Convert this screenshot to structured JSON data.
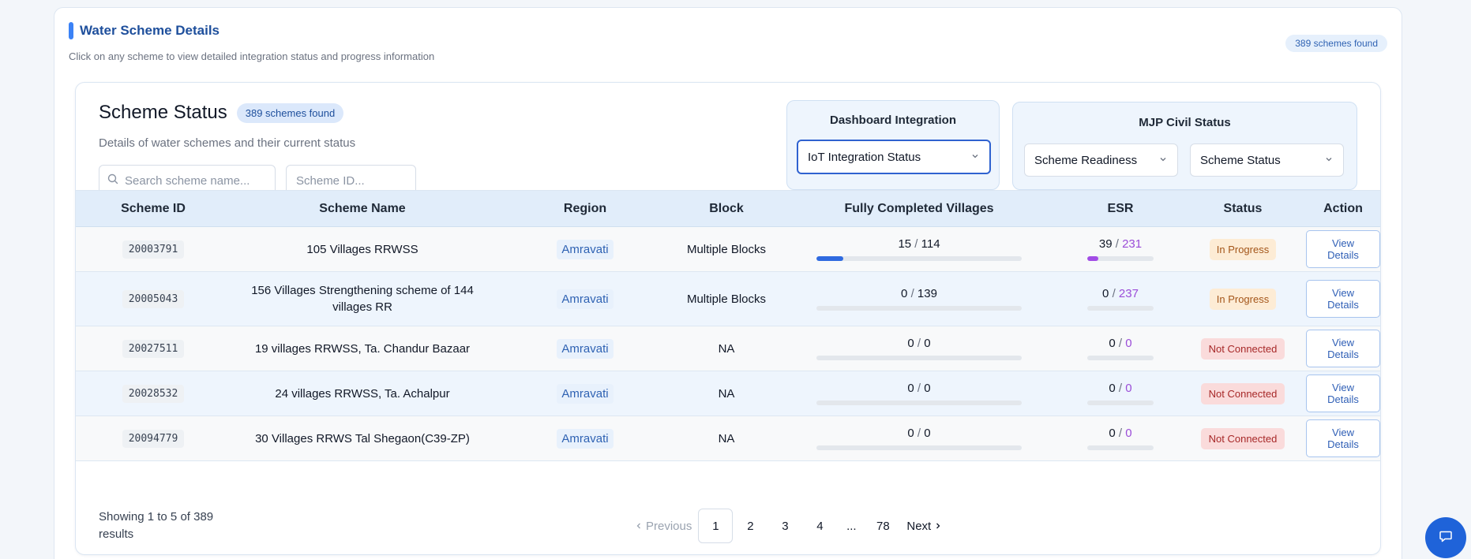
{
  "section": {
    "title": "Water Scheme Details",
    "subtitle": "Click on any scheme to view detailed integration status and progress information",
    "count_badge": "389 schemes found"
  },
  "scheme_status": {
    "title": "Scheme Status",
    "count_badge": "389 schemes found",
    "subtitle": "Details of water schemes and their current status",
    "search_placeholder": "Search scheme name...",
    "id_placeholder": "Scheme ID..."
  },
  "dashboard_integration": {
    "title": "Dashboard Integration",
    "select_value": "IoT Integration Status"
  },
  "mjp_civil_status": {
    "title": "MJP Civil Status",
    "readiness_value": "Scheme Readiness",
    "status_value": "Scheme Status"
  },
  "table": {
    "headers": [
      "Scheme ID",
      "Scheme Name",
      "Region",
      "Block",
      "Fully Completed Villages",
      "ESR",
      "Status",
      "Action"
    ],
    "rows": [
      {
        "id": "20003791",
        "name": "105 Villages RRWSS",
        "region": "Amravati",
        "block": "Multiple Blocks",
        "fcv_done": "15",
        "fcv_total": "114",
        "fcv_frac": 0.13,
        "esr_done": "39",
        "esr_total": "231",
        "esr_frac": 0.17,
        "status": "In Progress",
        "status_kind": "progress",
        "action": "View Details"
      },
      {
        "id": "20005043",
        "name": "156 Villages Strengthening scheme of 144 villages RR",
        "region": "Amravati",
        "block": "Multiple Blocks",
        "fcv_done": "0",
        "fcv_total": "139",
        "fcv_frac": 0,
        "esr_done": "0",
        "esr_total": "237",
        "esr_frac": 0,
        "status": "In Progress",
        "status_kind": "progress",
        "action": "View Details"
      },
      {
        "id": "20027511",
        "name": "19 villages RRWSS, Ta. Chandur Bazaar",
        "region": "Amravati",
        "block": "NA",
        "fcv_done": "0",
        "fcv_total": "0",
        "fcv_frac": 0,
        "esr_done": "0",
        "esr_total": "0",
        "esr_frac": 0,
        "status": "Not Connected",
        "status_kind": "nc",
        "action": "View Details"
      },
      {
        "id": "20028532",
        "name": "24 villages RRWSS, Ta. Achalpur",
        "region": "Amravati",
        "block": "NA",
        "fcv_done": "0",
        "fcv_total": "0",
        "fcv_frac": 0,
        "esr_done": "0",
        "esr_total": "0",
        "esr_frac": 0,
        "status": "Not Connected",
        "status_kind": "nc",
        "action": "View Details"
      },
      {
        "id": "20094779",
        "name": "30 Villages RRWS Tal Shegaon(C39-ZP)",
        "region": "Amravati",
        "block": "NA",
        "fcv_done": "0",
        "fcv_total": "0",
        "fcv_frac": 0,
        "esr_done": "0",
        "esr_total": "0",
        "esr_frac": 0,
        "status": "Not Connected",
        "status_kind": "nc",
        "action": "View Details"
      }
    ]
  },
  "footer": {
    "showing_prefix": "Showing",
    "from": "1",
    "to_word": "to",
    "to": "5",
    "of_word": "of",
    "total": "389",
    "results_word": "results"
  },
  "pagination": {
    "previous": "Previous",
    "pages": [
      "1",
      "2",
      "3",
      "4",
      "...",
      "78"
    ],
    "current": "1",
    "next": "Next"
  }
}
